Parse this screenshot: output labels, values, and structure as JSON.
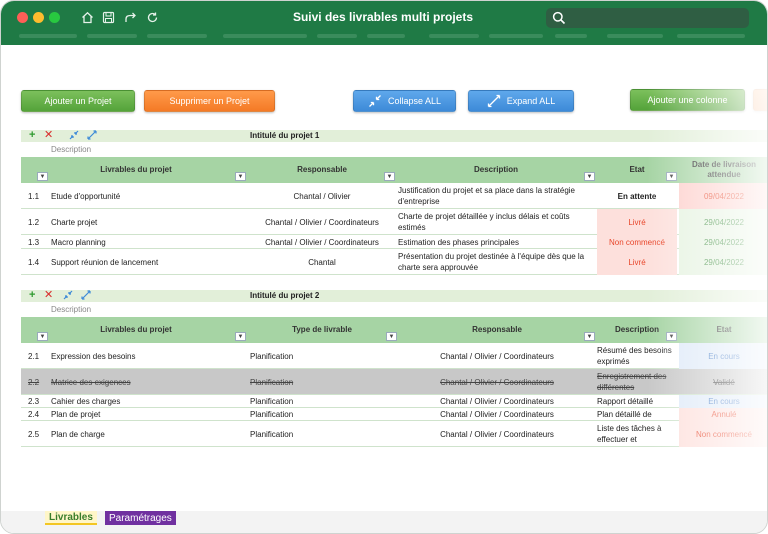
{
  "window": {
    "title": "Suivi des livrables multi projets"
  },
  "toolbar": {
    "add_project": "Ajouter un Projet",
    "delete_project": "Supprimer un Projet",
    "collapse_all": "Collapse ALL",
    "expand_all": "Expand ALL",
    "add_column": "Ajouter une colonne"
  },
  "project1": {
    "title": "Intitulé du projet 1",
    "description_label": "Description",
    "headers": [
      "Livrables du projet",
      "Responsable",
      "Description",
      "Etat",
      "Date de livraison attendue"
    ],
    "rows": [
      {
        "num": "1.1",
        "livrable": "Etude d'opportunité",
        "responsable": "Chantal / Olivier",
        "description": "Justification du projet et sa place dans la stratégie d'entreprise",
        "etat": "En attente",
        "date": "09/04/2022"
      },
      {
        "num": "1.2",
        "livrable": "Charte projet",
        "responsable": "Chantal / Olivier / Coordinateurs",
        "description": "Charte de projet détaillée y inclus délais et coûts estimés",
        "etat": "Livré",
        "date": "29/04/2022"
      },
      {
        "num": "1.3",
        "livrable": "Macro planning",
        "responsable": "Chantal / Olivier / Coordinateurs",
        "description": "Estimation des phases principales",
        "etat": "Non commencé",
        "date": "29/04/2022"
      },
      {
        "num": "1.4",
        "livrable": "Support réunion de lancement",
        "responsable": "Chantal",
        "description": "Présentation du projet destinée à l'équipe dès que la charte sera approuvée",
        "etat": "Livré",
        "date": "29/04/2022"
      }
    ]
  },
  "project2": {
    "title": "Intitulé du projet 2",
    "description_label": "Description",
    "headers": [
      "Livrables du projet",
      "Type de livrable",
      "Responsable",
      "Description",
      "Etat"
    ],
    "rows": [
      {
        "num": "2.1",
        "livrable": "Expression des besoins",
        "type": "Planification",
        "responsable": "Chantal / Olivier / Coordinateurs",
        "description": "Résumé des besoins exprimés",
        "etat": "En cours"
      },
      {
        "num": "2.2",
        "livrable": "Matrice des exigences",
        "type": "Planification",
        "responsable": "Chantal / Olivier / Coordinateurs",
        "description": "Enregistrement des différentes",
        "etat": "Validé"
      },
      {
        "num": "2.3",
        "livrable": "Cahier des charges",
        "type": "Planification",
        "responsable": "Chantal / Olivier / Coordinateurs",
        "description": "Rapport détaillé",
        "etat": "En cours"
      },
      {
        "num": "2.4",
        "livrable": "Plan de projet",
        "type": "Planification",
        "responsable": "Chantal / Olivier / Coordinateurs",
        "description": "Plan détaillé de",
        "etat": "Annulé"
      },
      {
        "num": "2.5",
        "livrable": "Plan de charge",
        "type": "Planification",
        "responsable": "Chantal / Olivier / Coordinateurs",
        "description": "Liste des tâches à effectuer et",
        "etat": "Non commencé"
      }
    ]
  },
  "sheets": {
    "tab1": "Livrables",
    "tab2": "Paramétrages"
  },
  "colors": {
    "titlebar": "#1f7a45",
    "header_green": "#a6d4a4",
    "status_red_bg": "#fde0dc",
    "status_red_text": "#e8472c",
    "status_blue_bg": "#dfeaf8",
    "status_blue_text": "#4a7fc7",
    "date_green_text": "#3c8c3c"
  }
}
